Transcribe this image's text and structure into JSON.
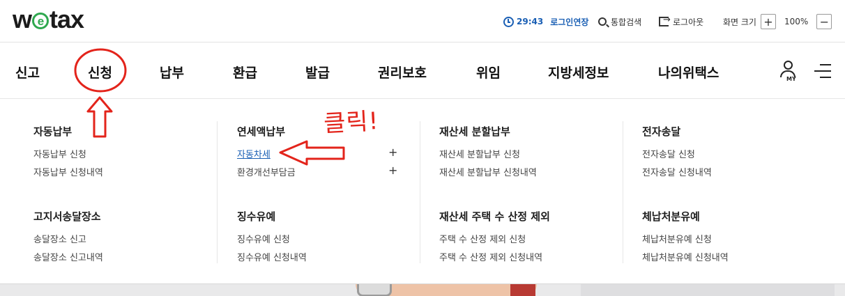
{
  "logo": {
    "text_left": "w",
    "text_mid": "e",
    "text_right": "tax"
  },
  "util": {
    "time": "29:43",
    "extend_login": "로그인연장",
    "search": "통합검색",
    "logout": "로그아웃",
    "zoom_label": "화면 크기",
    "zoom_in": "+",
    "zoom_value": "100%",
    "zoom_out": "−"
  },
  "nav": {
    "items": [
      "신고",
      "신청",
      "납부",
      "환급",
      "발급",
      "권리보호",
      "위임",
      "지방세정보",
      "나의위택스"
    ],
    "my_label": "MY"
  },
  "mega": {
    "groups": [
      {
        "title": "자동납부",
        "items": [
          "자동납부 신청",
          "자동납부 신청내역"
        ]
      },
      {
        "title": "연세액납부",
        "items": [
          "자동차세",
          "환경개선부담금"
        ]
      },
      {
        "title": "재산세 분할납부",
        "items": [
          "재산세 분할납부 신청",
          "재산세 분할납부 신청내역"
        ]
      },
      {
        "title": "전자송달",
        "items": [
          "전자송달 신청",
          "전자송달 신청내역"
        ]
      },
      {
        "title": "고지서송달장소",
        "items": [
          "송달장소 신고",
          "송달장소 신고내역"
        ]
      },
      {
        "title": "징수유예",
        "items": [
          "징수유예 신청",
          "징수유예 신청내역"
        ]
      },
      {
        "title": "재산세 주택 수 산정 제외",
        "items": [
          "주택 수 산정 제외 신청",
          "주택 수 산정 제외 신청내역"
        ]
      },
      {
        "title": "체납처분유예",
        "items": [
          "체납처분유예 신청",
          "체납처분유예 신청내역"
        ]
      }
    ],
    "expand_symbol": "+"
  },
  "annotation": {
    "note": "클릭!",
    "color": "#e3241b"
  },
  "colors": {
    "accent": "#1a5fb4",
    "logo_green": "#2fa84f",
    "annotation_red": "#e3241b"
  }
}
